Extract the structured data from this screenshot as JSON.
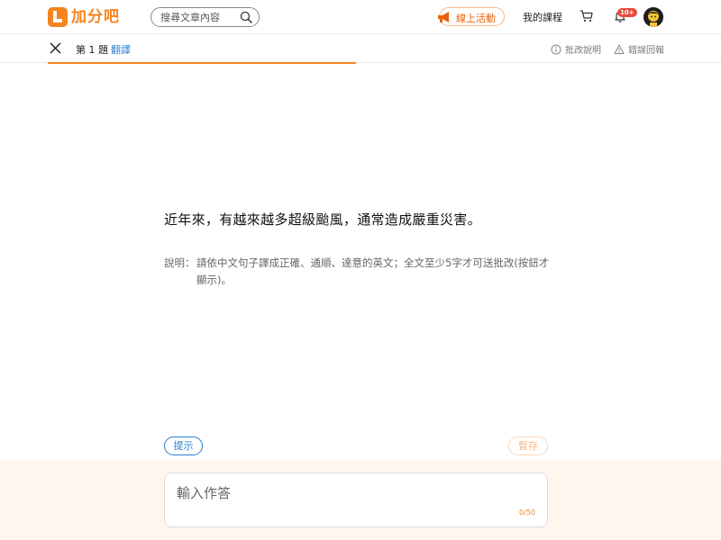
{
  "header": {
    "logo_text": "加分吧",
    "search": {
      "placeholder": "搜尋文章內容"
    },
    "event_label": "線上活動",
    "courses_label": "我的課程",
    "notification_count": "10+"
  },
  "subbar": {
    "question_number": "第 1 題",
    "question_type": "翻譯",
    "grading_label": "批改說明",
    "report_label": "錯誤回報"
  },
  "question": {
    "text": "近年來，有越來越多超級颱風，通常造成嚴重災害。",
    "instruction_label": "說明：",
    "instruction_body": "請依中文句子譯成正確、通順、達意的英文；全文至少5字才可送批改(按鈕才顯示)。"
  },
  "actions": {
    "hint_label": "提示",
    "save_label": "暫存"
  },
  "answer": {
    "placeholder": "輸入作答",
    "counter": "0/50"
  },
  "colors": {
    "brand_orange": "#f5841f",
    "link_blue": "#2b7fd6",
    "badge_red": "#e84b3c"
  }
}
